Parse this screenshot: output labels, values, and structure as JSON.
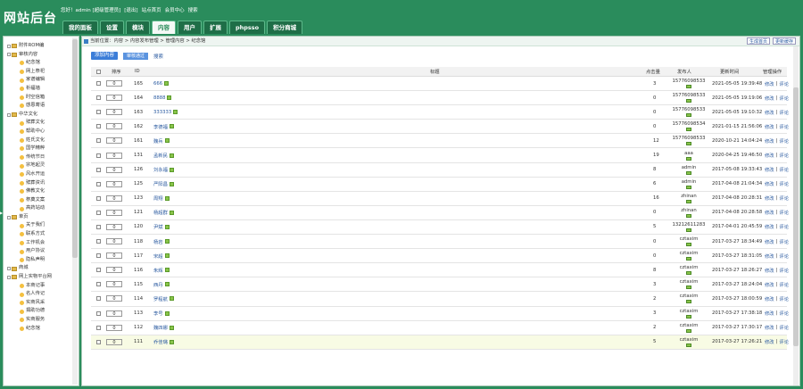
{
  "header": {
    "logo": "网站后台",
    "top_links": [
      "您好！admin [超级管理员]",
      "[退出]",
      "站点首页",
      "会员中心",
      "搜索"
    ],
    "tabs": [
      "我的面板",
      "设置",
      "模块",
      "内容",
      "用户",
      "扩展",
      "phpsso",
      "积分商城"
    ],
    "active_tab": 3
  },
  "sidebar": {
    "items": [
      {
        "label": "附件ROM编",
        "level": 0
      },
      {
        "label": "审核内容",
        "level": 0
      },
      {
        "label": "纪念馆",
        "level": 1
      },
      {
        "label": "网上祭祀",
        "level": 1
      },
      {
        "label": "家谱编辑",
        "level": 1
      },
      {
        "label": "祈福墙",
        "level": 1
      },
      {
        "label": "时空信箱",
        "level": 1
      },
      {
        "label": "感恩寄语",
        "level": 1
      },
      {
        "label": "中华文化",
        "level": 0
      },
      {
        "label": "殡葬文化",
        "level": 1
      },
      {
        "label": "帮助中心",
        "level": 1
      },
      {
        "label": "姓氏文化",
        "level": 1
      },
      {
        "label": "国学精粹",
        "level": 1
      },
      {
        "label": "传统节日",
        "level": 1
      },
      {
        "label": "宗地起灵",
        "level": 1
      },
      {
        "label": "风水开运",
        "level": 1
      },
      {
        "label": "殡葬资讯",
        "level": 1
      },
      {
        "label": "佛教文化",
        "level": 1
      },
      {
        "label": "祭奠文案",
        "level": 1
      },
      {
        "label": "高药站动",
        "level": 1
      },
      {
        "label": "单页",
        "level": 0
      },
      {
        "label": "关于我们",
        "level": 1
      },
      {
        "label": "联系方式",
        "level": 1
      },
      {
        "label": "工作机会",
        "level": 1
      },
      {
        "label": "用户协议",
        "level": 1
      },
      {
        "label": "隐私声明",
        "level": 1
      },
      {
        "label": "商城",
        "level": 0
      },
      {
        "label": "网上实物平台网",
        "level": 0
      },
      {
        "label": "本商记事",
        "level": 1
      },
      {
        "label": "名人传记",
        "level": 1
      },
      {
        "label": "实商风采",
        "level": 1
      },
      {
        "label": "捐助功德",
        "level": 1
      },
      {
        "label": "实商服务",
        "level": 1
      },
      {
        "label": "纪念馆",
        "level": 1
      }
    ]
  },
  "breadcrumb": "当前位置：内容 > 内容发布管理 > 管理内容 > 纪念馆",
  "right_buttons": [
    "生成首页",
    "更新缓存"
  ],
  "toolbar": {
    "add": "添加内容",
    "audit": "审核通过",
    "search": "搜索"
  },
  "table": {
    "headers": {
      "order": "排序",
      "id": "ID",
      "title": "标题",
      "hits": "点击量",
      "publisher": "发布人",
      "updated": "更新时间",
      "ops": "管理操作"
    },
    "op_edit": "修改",
    "op_sep": "|",
    "op_comment": "评论",
    "rows": [
      {
        "order": "0",
        "id": "165",
        "title": "666",
        "hits": "3",
        "publisher": "15776098533",
        "updated": "2021-05-05 19:39:48"
      },
      {
        "order": "0",
        "id": "164",
        "title": "8888",
        "hits": "0",
        "publisher": "15776098533",
        "updated": "2021-05-05 19:19:06"
      },
      {
        "order": "0",
        "id": "163",
        "title": "333333",
        "hits": "0",
        "publisher": "15776098533",
        "updated": "2021-05-05 19:10:32"
      },
      {
        "order": "0",
        "id": "162",
        "title": "李德福",
        "hits": "0",
        "publisher": "15776098534",
        "updated": "2021-01-15 21:56:06"
      },
      {
        "order": "0",
        "id": "161",
        "title": "魏兵",
        "hits": "12",
        "publisher": "15776098533",
        "updated": "2020-10-21 14:04:24"
      },
      {
        "order": "0",
        "id": "131",
        "title": "孟新民",
        "hits": "19",
        "publisher": "aaa",
        "updated": "2020-04-25 19:46:50"
      },
      {
        "order": "0",
        "id": "126",
        "title": "刘永福",
        "hits": "8",
        "publisher": "admin",
        "updated": "2017-05-08 19:33:43"
      },
      {
        "order": "0",
        "id": "125",
        "title": "严阳昌",
        "hits": "6",
        "publisher": "admin",
        "updated": "2017-04-08 21:04:34"
      },
      {
        "order": "0",
        "id": "123",
        "title": "周翔",
        "hits": "16",
        "publisher": "zhinan",
        "updated": "2017-04-08 20:28:31"
      },
      {
        "order": "0",
        "id": "121",
        "title": "杨超群",
        "hits": "0",
        "publisher": "zhinan",
        "updated": "2017-04-08 20:28:58"
      },
      {
        "order": "0",
        "id": "120",
        "title": "尹斌",
        "hits": "5",
        "publisher": "13212611283",
        "updated": "2017-04-01 20:45:59"
      },
      {
        "order": "0",
        "id": "118",
        "title": "杨岩",
        "hits": "0",
        "publisher": "cztaxim",
        "updated": "2017-03-27 18:34:49"
      },
      {
        "order": "0",
        "id": "117",
        "title": "宋超",
        "hits": "0",
        "publisher": "cztaxim",
        "updated": "2017-03-27 18:31:05"
      },
      {
        "order": "0",
        "id": "116",
        "title": "朱辉",
        "hits": "8",
        "publisher": "cztaxim",
        "updated": "2017-03-27 18:26:27"
      },
      {
        "order": "0",
        "id": "115",
        "title": "西丹",
        "hits": "3",
        "publisher": "cztaxim",
        "updated": "2017-03-27 18:24:04"
      },
      {
        "order": "0",
        "id": "114",
        "title": "罗程航",
        "hits": "2",
        "publisher": "cztaxim",
        "updated": "2017-03-27 18:00:59"
      },
      {
        "order": "0",
        "id": "113",
        "title": "李号",
        "hits": "3",
        "publisher": "cztaxim",
        "updated": "2017-03-27 17:38:18"
      },
      {
        "order": "0",
        "id": "112",
        "title": "魏四娜",
        "hits": "2",
        "publisher": "cztaxim",
        "updated": "2017-03-27 17:30:17"
      },
      {
        "order": "0",
        "id": "111",
        "title": "乔佳璐",
        "hits": "5",
        "publisher": "cztaxim",
        "updated": "2017-03-27 17:26:21"
      }
    ]
  }
}
